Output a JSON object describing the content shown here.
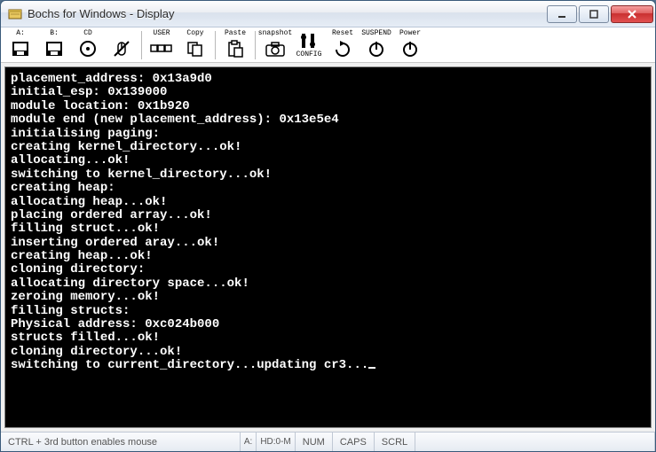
{
  "window": {
    "title": "Bochs for Windows - Display"
  },
  "toolbar": {
    "items": [
      {
        "label": "A:",
        "icon": "floppy-a-icon"
      },
      {
        "label": "B:",
        "icon": "floppy-b-icon"
      },
      {
        "label": "CD",
        "icon": "cd-icon"
      },
      {
        "label": "",
        "icon": "mouse-off-icon"
      },
      {
        "label": "USER",
        "icon": "user-keys-icon"
      },
      {
        "label": "Copy",
        "icon": "copy-icon"
      },
      {
        "label": "Paste",
        "icon": "paste-icon"
      },
      {
        "label": "snapshot",
        "icon": "snapshot-icon"
      },
      {
        "label": "CONFIG",
        "icon": "config-icon"
      },
      {
        "label": "Reset",
        "icon": "reset-icon"
      },
      {
        "label": "SUSPEND",
        "icon": "suspend-icon"
      },
      {
        "label": "Power",
        "icon": "power-icon"
      }
    ]
  },
  "terminal": {
    "lines": [
      "placement_address: 0x13a9d0",
      "initial_esp: 0x139000",
      "module location: 0x1b920",
      "module end (new placement_address): 0x13e5e4",
      "initialising paging:",
      "creating kernel_directory...ok!",
      "allocating...ok!",
      "switching to kernel_directory...ok!",
      "creating heap:",
      "allocating heap...ok!",
      "placing ordered array...ok!",
      "filling struct...ok!",
      "inserting ordered aray...ok!",
      "creating heap...ok!",
      "cloning directory:",
      "allocating directory space...ok!",
      "zeroing memory...ok!",
      "filling structs:",
      "Physical address: 0xc024b000",
      "structs filled...ok!",
      "cloning directory...ok!",
      "switching to current_directory...updating cr3..."
    ]
  },
  "statusbar": {
    "hint": "CTRL + 3rd button enables mouse",
    "drive": "A:",
    "hd": "HD:0-M",
    "num": "NUM",
    "caps": "CAPS",
    "scrl": "SCRL"
  }
}
